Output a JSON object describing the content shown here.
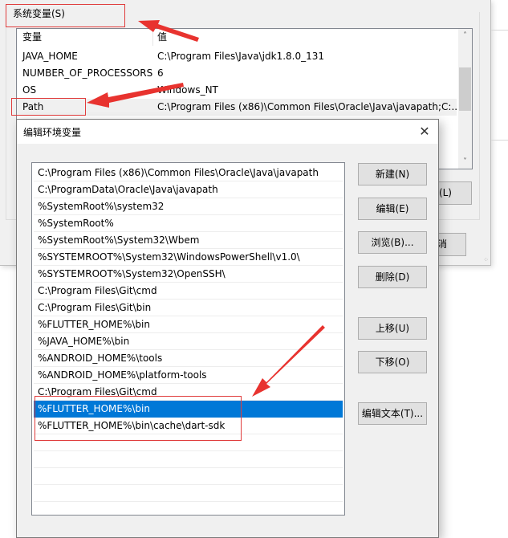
{
  "background_dialog": {
    "group_title": "系统变量(S)",
    "columns": [
      "变量",
      "值"
    ],
    "rows": [
      {
        "name": "JAVA_HOME",
        "value": "C:\\Program Files\\Java\\jdk1.8.0_131"
      },
      {
        "name": "NUMBER_OF_PROCESSORS",
        "value": "6"
      },
      {
        "name": "OS",
        "value": "Windows_NT"
      },
      {
        "name": "Path",
        "value": "C:\\Program Files (x86)\\Common Files\\Oracle\\Java\\javapath;C:..."
      }
    ],
    "selected_row": "Path",
    "partial_button_1": "除(L)",
    "partial_button_2": "消",
    "scroll_up_icon": "chevron-up-icon",
    "scroll_down_icon": "chevron-down-icon"
  },
  "edit_dialog": {
    "title": "编辑环境变量",
    "close_icon": "close-icon",
    "paths": [
      "C:\\Program Files (x86)\\Common Files\\Oracle\\Java\\javapath",
      "C:\\ProgramData\\Oracle\\Java\\javapath",
      "%SystemRoot%\\system32",
      "%SystemRoot%",
      "%SystemRoot%\\System32\\Wbem",
      "%SYSTEMROOT%\\System32\\WindowsPowerShell\\v1.0\\",
      "%SYSTEMROOT%\\System32\\OpenSSH\\",
      "C:\\Program Files\\Git\\cmd",
      "C:\\Program Files\\Git\\bin",
      "%FLUTTER_HOME%\\bin",
      "%JAVA_HOME%\\bin",
      "%ANDROID_HOME%\\tools",
      "%ANDROID_HOME%\\platform-tools",
      "C:\\Program Files\\Git\\cmd",
      "%FLUTTER_HOME%\\bin",
      "%FLUTTER_HOME%\\bin\\cache\\dart-sdk",
      "",
      "",
      "",
      "",
      "",
      ""
    ],
    "selected_index": 14,
    "buttons": {
      "new": "新建(N)",
      "edit": "编辑(E)",
      "browse": "浏览(B)...",
      "delete": "删除(D)",
      "move_up": "上移(U)",
      "move_down": "下移(O)",
      "edit_text": "编辑文本(T)..."
    }
  },
  "annotations": {
    "color": "#e03c3c"
  }
}
